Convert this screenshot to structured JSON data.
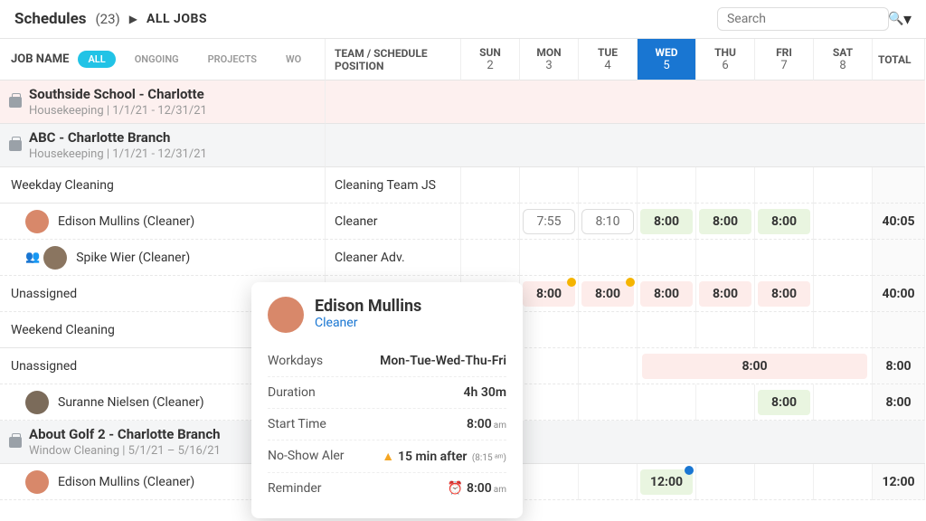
{
  "header": {
    "title": "Schedules",
    "count": "(23)",
    "breadcrumb": "ALL JOBS",
    "search_placeholder": "Search"
  },
  "filters": {
    "jobname_label": "JOB NAME",
    "all": "ALL",
    "ongoing": "ONGOING",
    "projects": "PROJECTS",
    "wo": "WO"
  },
  "columns": {
    "team": "TEAM / SCHEDULE POSITION",
    "days": [
      {
        "dow": "SUN",
        "num": "2"
      },
      {
        "dow": "MON",
        "num": "3"
      },
      {
        "dow": "TUE",
        "num": "4"
      },
      {
        "dow": "WED",
        "num": "5"
      },
      {
        "dow": "THU",
        "num": "6"
      },
      {
        "dow": "FRI",
        "num": "7"
      },
      {
        "dow": "SAT",
        "num": "8"
      }
    ],
    "total": "TOTAL"
  },
  "groups": [
    {
      "title": "Southside School - Charlotte",
      "sub": "Housekeeping | 1/1/21 - 12/31/21"
    },
    {
      "title": "ABC - Charlotte Branch",
      "sub": "Housekeeping | 1/1/21 - 12/31/21"
    },
    {
      "title": "About Golf 2 - Charlotte Branch",
      "sub": "Window Cleaning | 5/1/21 – 5/16/21"
    }
  ],
  "sections": {
    "weekday": "Weekday Cleaning",
    "weekend": "Weekend Cleaning",
    "unassigned": "Unassigned"
  },
  "team_labels": {
    "cleaning_team_js": "Cleaning Team JS",
    "cleaner": "Cleaner",
    "cleaner_adv": "Cleaner Adv."
  },
  "people": {
    "edison": "Edison Mullins (Cleaner)",
    "spike": "Spike Wier (Cleaner)",
    "suranne": "Suranne Nielsen (Cleaner)"
  },
  "times": {
    "t755": "7:55",
    "t810": "8:10",
    "t800": "8:00",
    "t1200": "12:00"
  },
  "totals": {
    "r1": "40:05",
    "r2": "40:00",
    "r3": "8:00",
    "r4": "8:00",
    "r5": "12:00"
  },
  "popup": {
    "name": "Edison Mullins",
    "role": "Cleaner",
    "workdays_k": "Workdays",
    "workdays_v": "Mon-Tue-Wed-Thu-Fri",
    "duration_k": "Duration",
    "duration_v": "4h 30m",
    "start_k": "Start Time",
    "start_v": "8:00",
    "noshow_k": "No-Show Aler",
    "noshow_v": "15 min after",
    "noshow_paren": "(8:15 ᵃᵐ)",
    "reminder_k": "Reminder",
    "reminder_v": "8:00",
    "am": "am"
  }
}
